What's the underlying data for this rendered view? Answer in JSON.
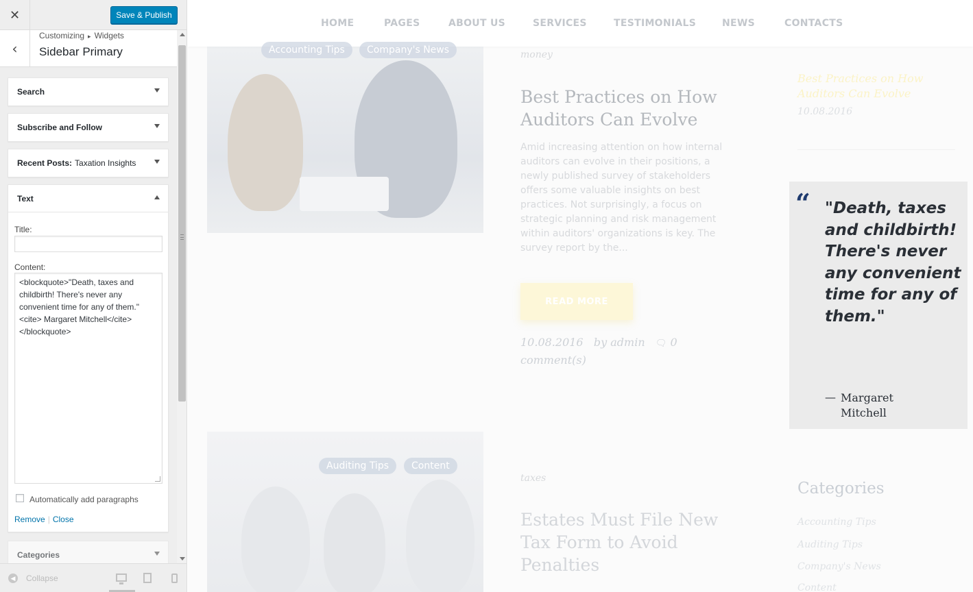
{
  "customizer": {
    "close_icon": "close-icon",
    "publish_label": "Save & Publish",
    "breadcrumb": [
      "Customizing",
      "Widgets"
    ],
    "breadcrumb_sep": "▸",
    "section_title": "Sidebar Primary",
    "widgets": [
      {
        "title": "Search",
        "subtitle": ""
      },
      {
        "title": "Subscribe and Follow",
        "subtitle": ""
      },
      {
        "title": "Recent Posts:",
        "subtitle": "Taxation Insights"
      }
    ],
    "text_widget": {
      "title": "Text",
      "title_label": "Title:",
      "title_value": "",
      "content_label": "Content:",
      "content_value": "<blockquote>\"Death, taxes and childbirth! There's never any convenient time for any of them.\" <cite> Margaret Mitchell</cite> </blockquote>",
      "autop_label": "Automatically add paragraphs",
      "autop_checked": false,
      "remove_label": "Remove",
      "actions_sep": "|",
      "close_label": "Close"
    },
    "next_widget": {
      "title": "Categories"
    },
    "footer": {
      "collapse_label": "Collapse",
      "active_device": "desktop"
    }
  },
  "preview": {
    "nav": [
      "HOME",
      "PAGES",
      "ABOUT US",
      "SERVICES",
      "TESTIMONIALS",
      "NEWS",
      "CONTACTS"
    ],
    "post1": {
      "tags": [
        "Accounting Tips",
        "Company's News"
      ],
      "category": "money",
      "title": "Best Practices on How Auditors Can Evolve",
      "excerpt": "Amid increasing attention on how internal auditors can evolve in their positions, a newly published survey of stakeholders offers some valuable insights on best practices. Not surprisingly, a focus on strategic planning and risk management within auditors' organizations is key. The survey report by the...",
      "read_more": "READ MORE",
      "date": "10.08.2016",
      "author": "by admin",
      "comments_count": "0",
      "comments_label": "comment(s)"
    },
    "post2": {
      "tags": [
        "Auditing Tips",
        "Content"
      ],
      "category": "taxes",
      "title": "Estates Must File New Tax Form to Avoid Penalties"
    },
    "sidebar": {
      "recent_post_title": "Best Practices on How Auditors Can Evolve",
      "recent_post_date": "10.08.2016",
      "quote_mark": "“",
      "quote_text": "\"Death, taxes and childbirth! There's never any convenient time for any of them.\"",
      "quote_dash": "—",
      "quote_cite": "Margaret Mitchell",
      "categories_title": "Categories",
      "categories": [
        "Accounting Tips",
        "Auditing Tips",
        "Company's News",
        "Content"
      ]
    }
  },
  "colors": {
    "publish_blue": "#0085ba",
    "link_blue": "#0073aa",
    "quote_navy": "#1e3a6e"
  }
}
